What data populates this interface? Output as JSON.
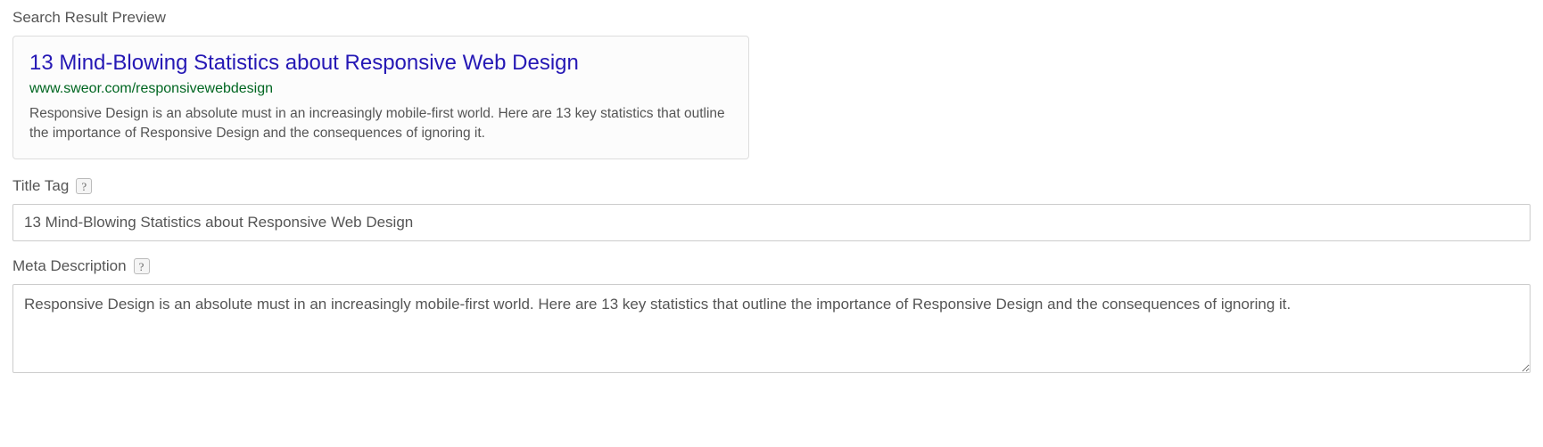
{
  "searchPreview": {
    "label": "Search Result Preview",
    "title": "13 Mind-Blowing Statistics about Responsive Web Design",
    "url": "www.sweor.com/responsivewebdesign",
    "description": "Responsive Design is an absolute must in an increasingly mobile-first world. Here are 13 key statistics that outline the importance of Responsive Design and the consequences of ignoring it."
  },
  "titleTag": {
    "label": "Title Tag",
    "helpSymbol": "?",
    "value": "13 Mind-Blowing Statistics about Responsive Web Design"
  },
  "metaDescription": {
    "label": "Meta Description",
    "helpSymbol": "?",
    "value": "Responsive Design is an absolute must in an increasingly mobile-first world. Here are 13 key statistics that outline the importance of Responsive Design and the consequences of ignoring it."
  }
}
